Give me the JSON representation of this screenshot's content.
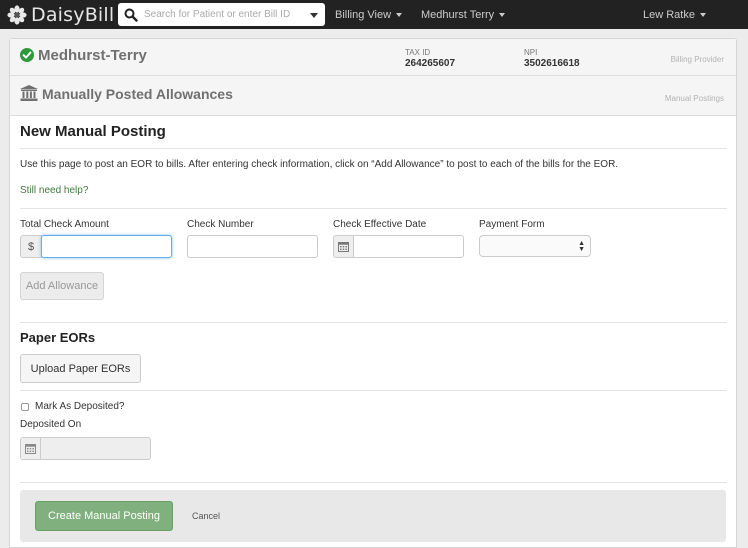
{
  "app": {
    "brand": "DaisyBill"
  },
  "nav": {
    "search_placeholder": "Search for Patient or enter Bill ID",
    "billing_view": "Billing View",
    "practice": "Medhurst Terry",
    "user": "Lew Ratke"
  },
  "provider": {
    "name": "Medhurst-Terry",
    "tax_id_label": "TAX ID",
    "tax_id": "264265607",
    "npi_label": "NPI",
    "npi": "3502616618",
    "section_label": "Billing Provider"
  },
  "page": {
    "title": "Manually Posted Allowances",
    "section_label": "Manual Postings",
    "heading": "New Manual Posting",
    "intro": "Use this page to post an EOR to bills. After entering check information, click on “Add Allowance” to post to each of the bills for the EOR.",
    "help_link": "Still need help?"
  },
  "form": {
    "total_check_amount_label": "Total Check Amount",
    "currency_symbol": "$",
    "total_check_amount_value": "",
    "check_number_label": "Check Number",
    "check_number_value": "",
    "check_effective_date_label": "Check Effective Date",
    "check_effective_date_value": "",
    "payment_form_label": "Payment Form",
    "payment_form_value": "",
    "add_allowance_label": "Add Allowance"
  },
  "paper_eors": {
    "heading": "Paper EORs",
    "upload_label": "Upload Paper EORs"
  },
  "deposit": {
    "mark_label": "Mark As Deposited?",
    "mark_checked": false,
    "deposited_on_label": "Deposited On",
    "deposited_on_value": ""
  },
  "actions": {
    "create_label": "Create Manual Posting",
    "cancel_label": "Cancel"
  },
  "colors": {
    "topbar": "#222222",
    "accent_green": "#7fb07d",
    "check_green": "#2e9a3b",
    "link_green": "#3e7a3e"
  }
}
